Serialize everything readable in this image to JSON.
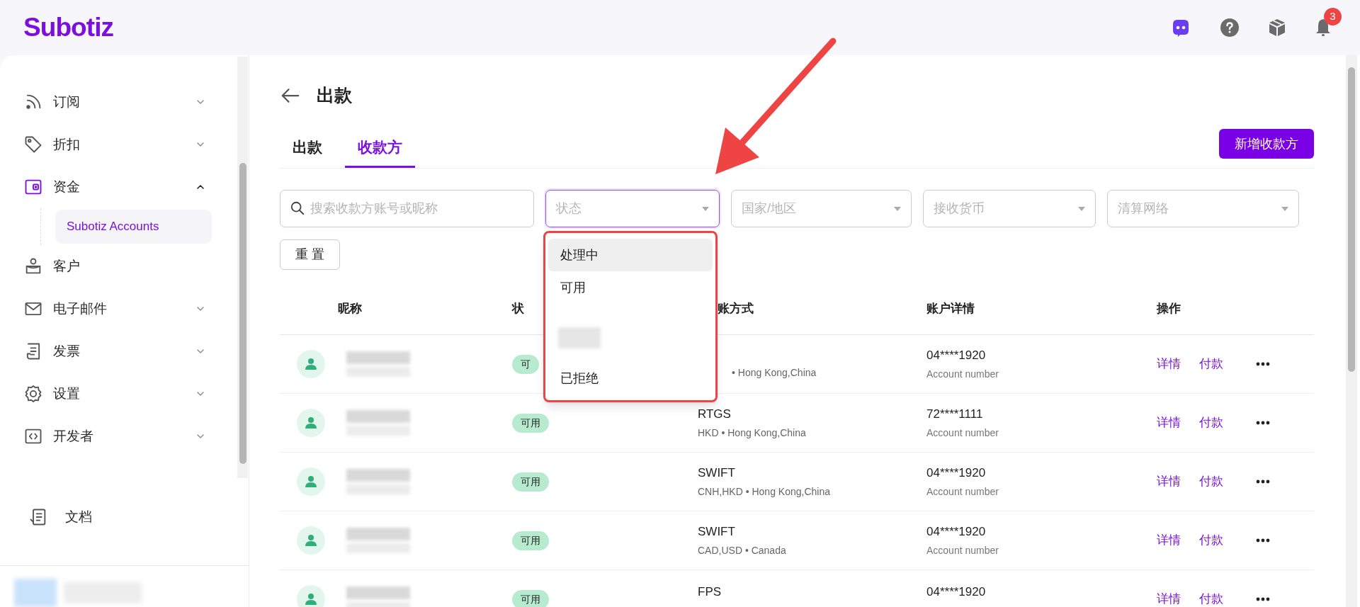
{
  "header": {
    "logo": "Subotiz",
    "notification_count": "3"
  },
  "sidebar": {
    "items": [
      {
        "label": "订阅",
        "expanded": false,
        "selected": false
      },
      {
        "label": "折扣",
        "expanded": false,
        "selected": false
      },
      {
        "label": "资金",
        "expanded": true,
        "selected": true,
        "children": [
          {
            "label": "Subotiz Accounts",
            "selected": true
          }
        ]
      },
      {
        "label": "客户",
        "selected": false
      },
      {
        "label": "电子邮件",
        "expanded": false,
        "selected": false
      },
      {
        "label": "发票",
        "expanded": false,
        "selected": false
      },
      {
        "label": "设置",
        "expanded": false,
        "selected": false
      },
      {
        "label": "开发者",
        "expanded": false,
        "selected": false
      }
    ],
    "footer_link": "文档"
  },
  "page": {
    "title": "出款",
    "tabs": [
      {
        "label": "出款",
        "selected": false
      },
      {
        "label": "收款方",
        "selected": true
      }
    ],
    "add_button": "新增收款方",
    "search": {
      "placeholder": "搜索收款方账号或昵称"
    },
    "filters": [
      {
        "placeholder": "状态",
        "focused": true
      },
      {
        "placeholder": "国家/地区",
        "focused": false
      },
      {
        "placeholder": "接收货币",
        "focused": false
      },
      {
        "placeholder": "清算网络",
        "focused": false
      }
    ],
    "reset_button": "重 置",
    "status_dropdown": [
      {
        "kind": "option",
        "label": "处理中",
        "selected": true
      },
      {
        "kind": "option",
        "label": "可用",
        "selected": false
      },
      {
        "kind": "redacted"
      },
      {
        "kind": "option",
        "label": "已拒绝",
        "selected": false
      }
    ],
    "table": {
      "columns": [
        "昵称",
        "状",
        "账方式",
        "账户详情",
        "操作"
      ],
      "rows": [
        {
          "status": "可",
          "method_detail": "• Hong Kong,China",
          "account": "04****1920",
          "account_label": "Account number",
          "actions": [
            "详情",
            "付款"
          ]
        },
        {
          "status": "可用",
          "method": "RTGS",
          "method_detail": "HKD • Hong Kong,China",
          "account": "72****1111",
          "account_label": "Account number",
          "actions": [
            "详情",
            "付款"
          ]
        },
        {
          "status": "可用",
          "method": "SWIFT",
          "method_detail": "CNH,HKD • Hong Kong,China",
          "account": "04****1920",
          "account_label": "Account number",
          "actions": [
            "详情",
            "付款"
          ]
        },
        {
          "status": "可用",
          "method": "SWIFT",
          "method_detail": "CAD,USD • Canada",
          "account": "04****1920",
          "account_label": "Account number",
          "actions": [
            "详情",
            "付款"
          ]
        },
        {
          "status": "可用",
          "method": "FPS",
          "account": "04****1920",
          "actions": [
            "详情",
            "付款"
          ]
        }
      ]
    }
  }
}
